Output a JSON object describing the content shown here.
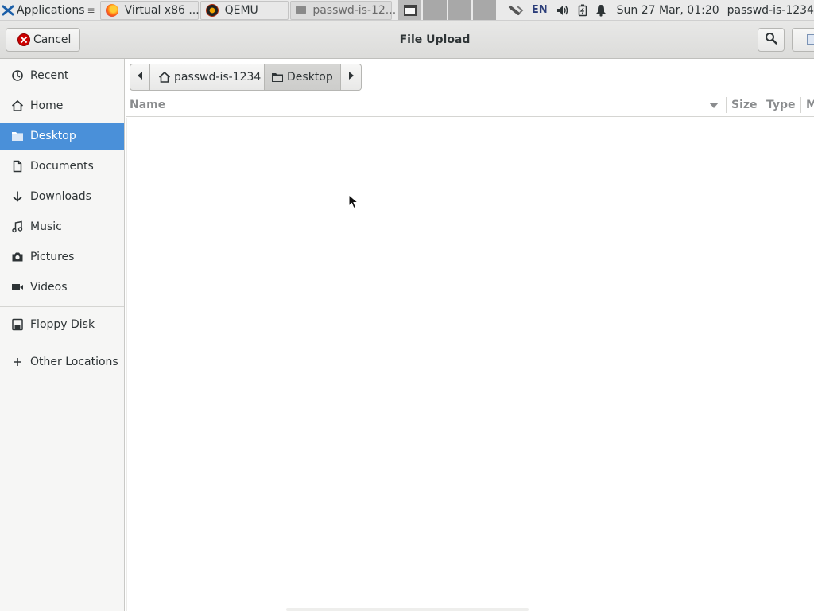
{
  "panel": {
    "app_menu_label": "Applications",
    "tasks": [
      {
        "label": "Virtual x86 ...",
        "icon": "firefox-icon"
      },
      {
        "label": "QEMU",
        "icon": "qemu-icon"
      },
      {
        "label": "passwd-is-12...",
        "icon": "window-icon"
      }
    ],
    "workspaces": [
      "1",
      "2",
      "3",
      "4"
    ],
    "active_workspace": 1,
    "tray": {
      "network_icon": "network-wired-icon",
      "keyboard_layout": "EN",
      "volume_icon": "volume-icon",
      "battery_icon": "battery-icon",
      "notification_icon": "bell-icon"
    },
    "clock": "Sun 27 Mar, 01:20",
    "user": "passwd-is-1234"
  },
  "dialog": {
    "title": "File Upload",
    "cancel_label": "Cancel",
    "search_icon": "search-icon",
    "accent_color": "#4a90d9"
  },
  "sidebar": {
    "items": [
      {
        "label": "Recent",
        "icon": "clock-icon"
      },
      {
        "label": "Home",
        "icon": "home-icon"
      },
      {
        "label": "Desktop",
        "icon": "folder-icon",
        "selected": true
      },
      {
        "label": "Documents",
        "icon": "document-icon"
      },
      {
        "label": "Downloads",
        "icon": "download-icon"
      },
      {
        "label": "Music",
        "icon": "music-icon"
      },
      {
        "label": "Pictures",
        "icon": "camera-icon"
      },
      {
        "label": "Videos",
        "icon": "video-icon"
      }
    ],
    "devices": [
      {
        "label": "Floppy Disk",
        "icon": "floppy-icon"
      }
    ],
    "other": {
      "label": "Other Locations",
      "icon": "plus-icon"
    }
  },
  "pathbar": {
    "home_label": "passwd-is-1234",
    "current_label": "Desktop"
  },
  "file_list": {
    "columns": [
      "Name",
      "Size",
      "Type",
      "M"
    ],
    "rows": []
  }
}
